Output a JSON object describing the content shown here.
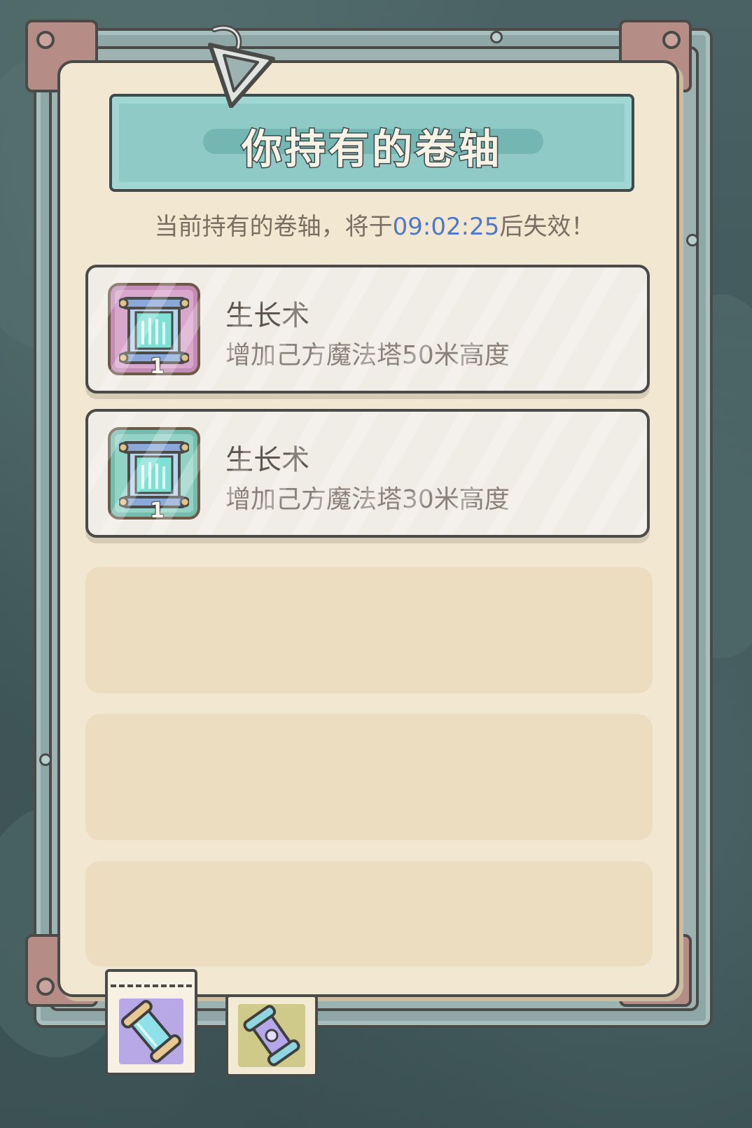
{
  "dialog": {
    "title": "你持有的卷轴",
    "subtitle_prefix": "当前持有的卷轴，将于",
    "timer": "09:02:25",
    "subtitle_suffix": "后失效！"
  },
  "scrolls": [
    {
      "name": "生长术",
      "description": "增加己方魔法塔50米高度",
      "count": "1",
      "rarity_color": "#d9a6cc"
    },
    {
      "name": "生长术",
      "description": "增加己方魔法塔30米高度",
      "count": "1",
      "rarity_color": "#93d3c5"
    }
  ],
  "tabs": [
    {
      "icon": "scroll-tab-icon-blue",
      "active": true
    },
    {
      "icon": "scroll-tab-icon-purple",
      "active": false
    }
  ],
  "colors": {
    "accent_timer": "#4f78c9",
    "banner": "#8fcac6",
    "panel": "#f2e8d2"
  }
}
